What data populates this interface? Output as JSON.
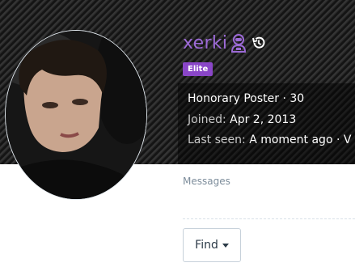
{
  "profile": {
    "username": "xerki",
    "username_color": "#9c6ad6",
    "icons": [
      "user-astronaut-icon",
      "history-icon"
    ],
    "badge": "Elite",
    "badge_color": "#8a46c8",
    "title_line": "Honorary Poster · 30",
    "joined_label": "Joined:",
    "joined_value": "Apr 2, 2013",
    "last_seen_label": "Last seen:",
    "last_seen_value": "A moment ago · V"
  },
  "stats": {
    "messages_label": "Messages"
  },
  "actions": {
    "find_label": "Find"
  }
}
